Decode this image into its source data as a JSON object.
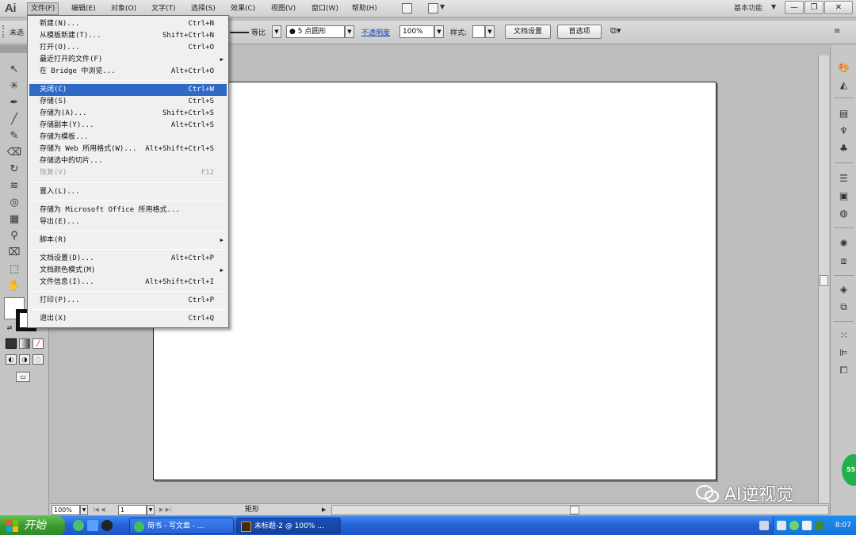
{
  "app": {
    "logo": "Ai"
  },
  "menubar": {
    "items": [
      "文件(F)",
      "编辑(E)",
      "对象(O)",
      "文字(T)",
      "选择(S)",
      "效果(C)",
      "视图(V)",
      "窗口(W)",
      "帮助(H)"
    ],
    "workspace": "基本功能",
    "window_controls": {
      "minimize": "—",
      "restore": "❐",
      "close": "✕"
    }
  },
  "controlbar": {
    "left_label": "未选",
    "stroke_profile": "等比",
    "brush": "5 点圆形",
    "opacity_label": "不透明度",
    "opacity_value": "100%",
    "style_label": "样式:",
    "doc_setup_button": "文档设置",
    "prefs_button": "首选项"
  },
  "file_menu": {
    "items": [
      {
        "label": "新建(N)...",
        "shortcut": "Ctrl+N"
      },
      {
        "label": "从模板新建(T)...",
        "shortcut": "Shift+Ctrl+N"
      },
      {
        "label": "打开(O)...",
        "shortcut": "Ctrl+O"
      },
      {
        "label": "最近打开的文件(F)",
        "shortcut": ""
      },
      {
        "label": "在 Bridge 中浏览...",
        "shortcut": "Alt+Ctrl+O"
      },
      {
        "label": "关闭(C)",
        "shortcut": "Ctrl+W"
      },
      {
        "label": "存储(S)",
        "shortcut": "Ctrl+S"
      },
      {
        "label": "存储为(A)...",
        "shortcut": "Shift+Ctrl+S"
      },
      {
        "label": "存储副本(Y)...",
        "shortcut": "Alt+Ctrl+S"
      },
      {
        "label": "存储为模板...",
        "shortcut": ""
      },
      {
        "label": "存储为 Web 所用格式(W)...",
        "shortcut": "Alt+Shift+Ctrl+S"
      },
      {
        "label": "存储选中的切片...",
        "shortcut": ""
      },
      {
        "label": "恢复(V)",
        "shortcut": "F12"
      },
      {
        "label": "置入(L)...",
        "shortcut": ""
      },
      {
        "label": "存储为 Microsoft Office 所用格式...",
        "shortcut": ""
      },
      {
        "label": "导出(E)...",
        "shortcut": ""
      },
      {
        "label": "脚本(R)",
        "shortcut": ""
      },
      {
        "label": "文档设置(D)...",
        "shortcut": "Alt+Ctrl+P"
      },
      {
        "label": "文档颜色模式(M)",
        "shortcut": ""
      },
      {
        "label": "文件信息(I)...",
        "shortcut": "Alt+Shift+Ctrl+I"
      },
      {
        "label": "打印(P)...",
        "shortcut": "Ctrl+P"
      },
      {
        "label": "退出(X)",
        "shortcut": "Ctrl+Q"
      }
    ],
    "submenu_arrow": "▶"
  },
  "statusbar": {
    "zoom": "100%",
    "page": "1",
    "tool": "矩形"
  },
  "badge": {
    "text": "55"
  },
  "watermark": {
    "text": "AI逆视觉"
  },
  "taskbar": {
    "start": "开始",
    "tasks": [
      "简书 - 写文章 - ...",
      "未标题-2 @ 100% ..."
    ],
    "clock": "8:07"
  }
}
